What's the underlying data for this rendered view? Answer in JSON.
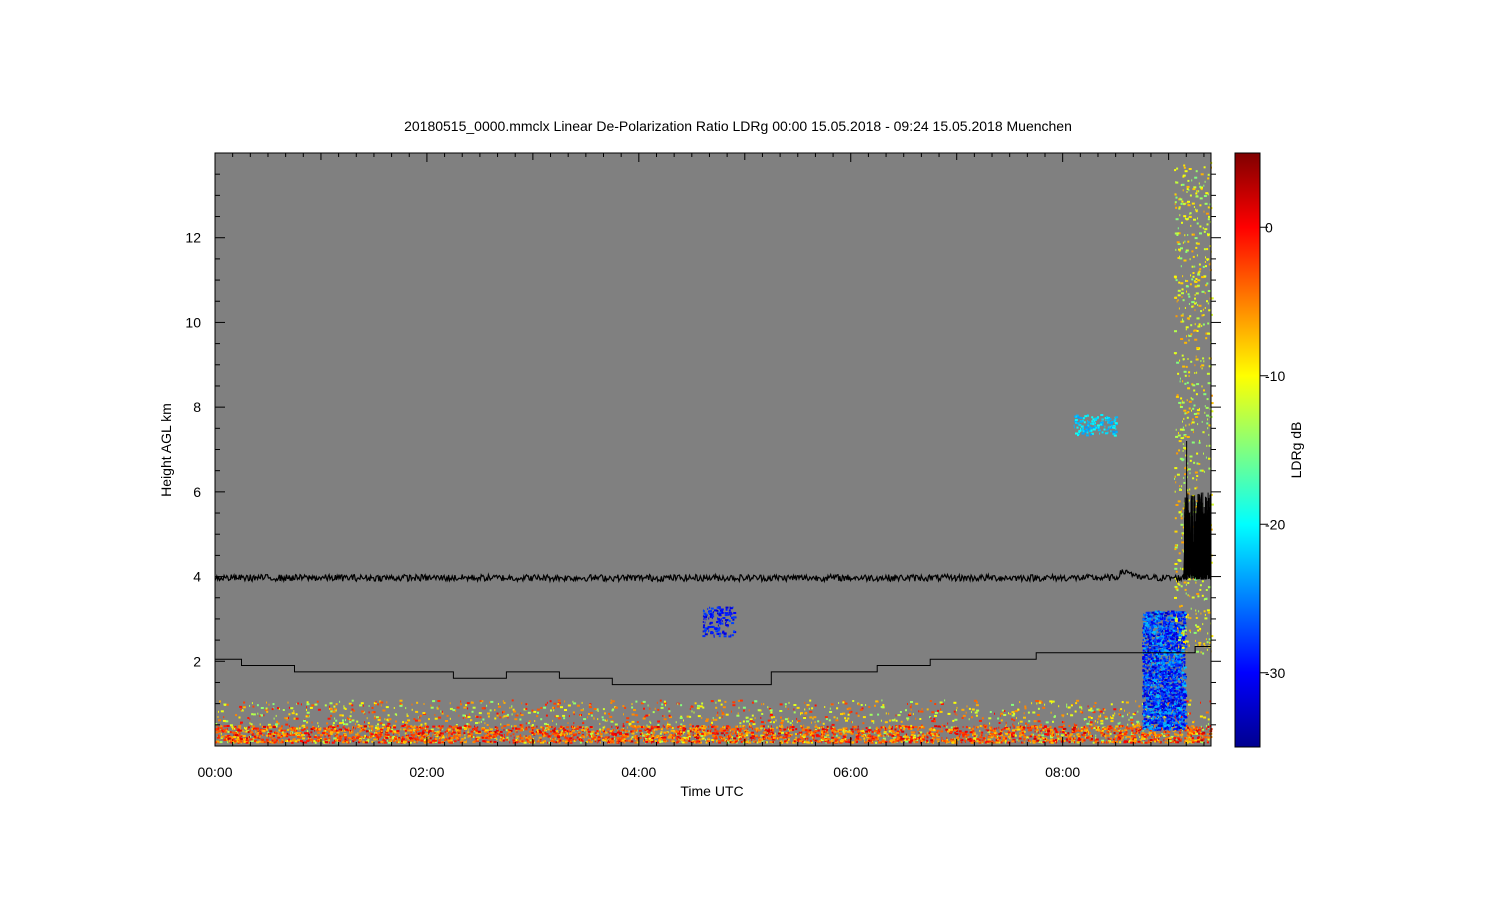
{
  "chart_data": {
    "type": "heatmap",
    "title": "20180515_0000.mmclx Linear De-Polarization Ratio LDRg   00:00 15.05.2018 - 09:24 15.05.2018 Muenchen",
    "xlabel": "Time UTC",
    "ylabel": "Height AGL km",
    "xlim_hours": [
      0,
      9.4
    ],
    "ylim_km": [
      0,
      14
    ],
    "x_ticks": [
      {
        "value": 0,
        "label": "00:00"
      },
      {
        "value": 2,
        "label": "02:00"
      },
      {
        "value": 4,
        "label": "04:00"
      },
      {
        "value": 6,
        "label": "06:00"
      },
      {
        "value": 8,
        "label": "08:00"
      }
    ],
    "y_ticks": [
      {
        "value": 2,
        "label": "2"
      },
      {
        "value": 4,
        "label": "4"
      },
      {
        "value": 6,
        "label": "6"
      },
      {
        "value": 8,
        "label": "8"
      },
      {
        "value": 10,
        "label": "10"
      },
      {
        "value": 12,
        "label": "12"
      }
    ],
    "background_color": "#808080",
    "colorbar": {
      "label": "LDRg dB",
      "range": [
        -35,
        5
      ],
      "ticks": [
        {
          "value": 0,
          "label": "0"
        },
        {
          "value": -10,
          "label": "-10"
        },
        {
          "value": -20,
          "label": "-20"
        },
        {
          "value": -30,
          "label": "-30"
        }
      ],
      "colormap": "jet"
    },
    "black_noise_line": {
      "mean_height_km": 3.97,
      "noise_amplitude_km": 0.08,
      "burst_start_hours": 9.15,
      "burst_max_height_km": 7.2,
      "burst_typical_top_km": 5.7
    },
    "step_line": [
      [
        0,
        2.05
      ],
      [
        0.25,
        1.9
      ],
      [
        0.75,
        1.75
      ],
      [
        2.25,
        1.6
      ],
      [
        2.75,
        1.75
      ],
      [
        3.25,
        1.6
      ],
      [
        3.75,
        1.45
      ],
      [
        5.25,
        1.75
      ],
      [
        6.25,
        1.9
      ],
      [
        6.75,
        2.05
      ],
      [
        7.75,
        2.2
      ],
      [
        9.25,
        2.35
      ],
      [
        9.4,
        2.35
      ]
    ],
    "echo_regions": [
      {
        "t_start": 0,
        "t_end": 9.4,
        "h_bottom": 0.1,
        "h_top": 1.1,
        "ldr_range": [
          -15,
          0
        ],
        "density": "high"
      },
      {
        "t_start": 0,
        "t_end": 9.4,
        "h_bottom": 0.1,
        "h_top": 0.5,
        "ldr_range": [
          -8,
          2
        ],
        "density": "very high"
      },
      {
        "t_start": 4.6,
        "t_end": 4.9,
        "h_bottom": 2.6,
        "h_top": 3.3,
        "ldr_range": [
          -32,
          -27
        ],
        "density": "low"
      },
      {
        "t_start": 8.1,
        "t_end": 8.5,
        "h_bottom": 7.35,
        "h_top": 7.85,
        "ldr_range": [
          -24,
          -19
        ],
        "density": "low"
      },
      {
        "t_start": 8.75,
        "t_end": 9.15,
        "h_bottom": 0.4,
        "h_top": 3.2,
        "ldr_range": [
          -33,
          -22
        ],
        "density": "high"
      },
      {
        "t_start": 9.05,
        "t_end": 9.4,
        "h_bottom": 2.2,
        "h_top": 13.8,
        "ldr_range": [
          -15,
          -6
        ],
        "density": "sparse"
      }
    ]
  }
}
